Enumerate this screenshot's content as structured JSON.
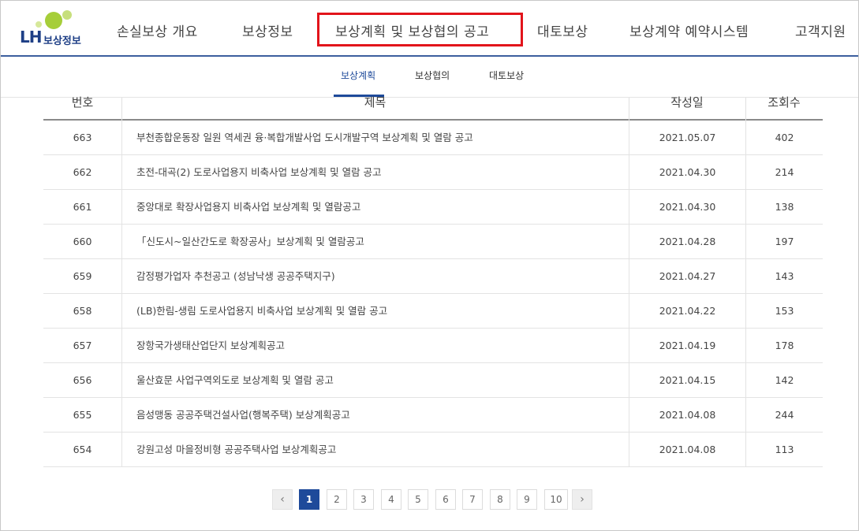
{
  "header": {
    "logo_text": "LH",
    "logo_sub": "보상정보",
    "nav": [
      {
        "label": "손실보상 개요"
      },
      {
        "label": "보상정보"
      },
      {
        "label": "보상계획 및 보상협의 공고"
      },
      {
        "label": "대토보상"
      },
      {
        "label": "보상계약 예약시스템"
      },
      {
        "label": "고객지원"
      }
    ],
    "highlight_color": "#e2141b"
  },
  "subnav": {
    "items": [
      {
        "label": "보상계획",
        "active": true
      },
      {
        "label": "보상협의",
        "active": false
      },
      {
        "label": "대토보상",
        "active": false
      }
    ],
    "active_color": "#1e4a9a"
  },
  "table": {
    "headers": {
      "no": "번호",
      "title": "제목",
      "date": "작성일",
      "views": "조회수"
    },
    "rows": [
      {
        "no": "663",
        "title": "부천종합운동장 일원 역세권 융·복합개발사업 도시개발구역 보상계획 및 열람 공고",
        "date": "2021.05.07",
        "views": "402"
      },
      {
        "no": "662",
        "title": "초전-대곡(2) 도로사업용지 비축사업 보상계획 및 열람 공고",
        "date": "2021.04.30",
        "views": "214"
      },
      {
        "no": "661",
        "title": "중앙대로 확장사업용지 비축사업 보상계획 및 열람공고",
        "date": "2021.04.30",
        "views": "138"
      },
      {
        "no": "660",
        "title": "「신도시~일산간도로 확장공사」보상계획 및 열람공고",
        "date": "2021.04.28",
        "views": "197"
      },
      {
        "no": "659",
        "title": "감정평가업자 추천공고 (성남낙생 공공주택지구)",
        "date": "2021.04.27",
        "views": "143"
      },
      {
        "no": "658",
        "title": "(LB)한림-생림 도로사업용지 비축사업 보상계획 및 열람 공고",
        "date": "2021.04.22",
        "views": "153"
      },
      {
        "no": "657",
        "title": "장항국가생태산업단지 보상계획공고",
        "date": "2021.04.19",
        "views": "178"
      },
      {
        "no": "656",
        "title": "울산효문 사업구역외도로 보상계획 및 열람 공고",
        "date": "2021.04.15",
        "views": "142"
      },
      {
        "no": "655",
        "title": "음성맹동 공공주택건설사업(행복주택) 보상계획공고",
        "date": "2021.04.08",
        "views": "244"
      },
      {
        "no": "654",
        "title": "강원고성 마을정비형 공공주택사업 보상계획공고",
        "date": "2021.04.08",
        "views": "113"
      }
    ]
  },
  "pagination": {
    "prev": "‹",
    "next": "›",
    "pages": [
      "1",
      "2",
      "3",
      "4",
      "5",
      "6",
      "7",
      "8",
      "9",
      "10"
    ],
    "current": "1"
  }
}
